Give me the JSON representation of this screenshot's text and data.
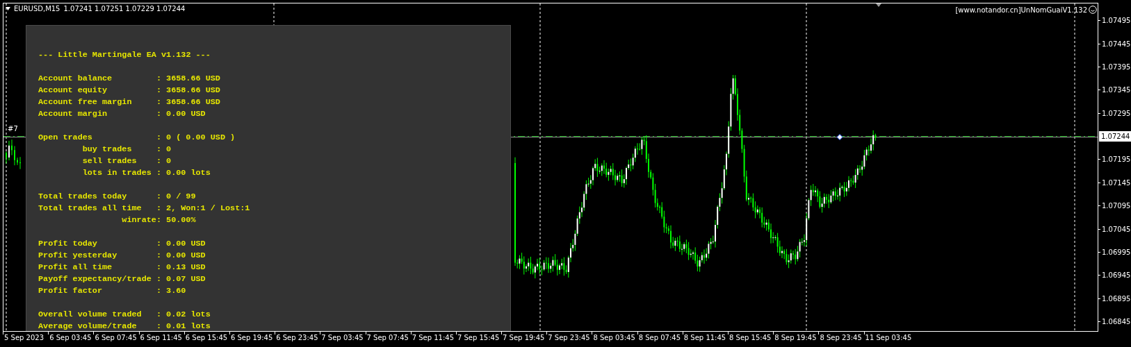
{
  "chart_header": {
    "symbol": "EURUSD,M15",
    "quotes": "1.07241 1.07251 1.07229 1.07244"
  },
  "indicator_label": "[www.notandor.cn]UnNomGuaiV1.132",
  "order_label": "#7",
  "panel": {
    "lines": [
      {
        "kind": "title",
        "text": "--- Little Martingale EA v1.132 ---"
      },
      {
        "kind": "gap"
      },
      {
        "kind": "row",
        "label": "Account balance",
        "value": ": 3658.66 USD"
      },
      {
        "kind": "row",
        "label": "Account equity",
        "value": ": 3658.66 USD"
      },
      {
        "kind": "row",
        "label": "Account free margin",
        "value": ": 3658.66 USD"
      },
      {
        "kind": "row",
        "label": "Account margin",
        "value": ": 0.00 USD"
      },
      {
        "kind": "gap"
      },
      {
        "kind": "row",
        "label": "Open trades",
        "value": ": 0 ( 0.00 USD )"
      },
      {
        "kind": "subrow",
        "label": "buy trades",
        "value": ": 0"
      },
      {
        "kind": "subrow",
        "label": "sell trades",
        "value": ": 0"
      },
      {
        "kind": "subrow",
        "label": "lots in trades",
        "value": ": 0.00 lots"
      },
      {
        "kind": "gap"
      },
      {
        "kind": "row",
        "label": "Total trades today",
        "value": ": 0 / 99"
      },
      {
        "kind": "row",
        "label": "Total trades all time",
        "value": ": 2, Won:1 / Lost:1"
      },
      {
        "kind": "right",
        "label": "winrate",
        "value": ": 50.00%"
      },
      {
        "kind": "gap"
      },
      {
        "kind": "row",
        "label": "Profit today",
        "value": ": 0.00 USD"
      },
      {
        "kind": "row",
        "label": "Profit yesterday",
        "value": ": 0.00 USD"
      },
      {
        "kind": "row",
        "label": "Profit all time",
        "value": ": 0.13 USD"
      },
      {
        "kind": "row",
        "label": "Payoff expectancy/trade",
        "value": ": 0.07 USD"
      },
      {
        "kind": "row",
        "label": "Profit factor",
        "value": ": 3.60"
      },
      {
        "kind": "gap"
      },
      {
        "kind": "row",
        "label": "Overall volume traded",
        "value": ": 0.02 lots"
      },
      {
        "kind": "row",
        "label": "Average volume/trade",
        "value": ": 0.01 lots"
      }
    ]
  },
  "price_axis": {
    "labels": [
      {
        "kind": "tick",
        "text": "1.07495"
      },
      {
        "kind": "tick",
        "text": "1.07445"
      },
      {
        "kind": "tick",
        "text": "1.07395"
      },
      {
        "kind": "tick",
        "text": "1.07345"
      },
      {
        "kind": "tick",
        "text": "1.07295"
      },
      {
        "kind": "current",
        "text": "1.07244"
      },
      {
        "kind": "tick",
        "text": "1.07195"
      },
      {
        "kind": "tick",
        "text": "1.07145"
      },
      {
        "kind": "tick",
        "text": "1.07095"
      },
      {
        "kind": "tick",
        "text": "1.07045"
      },
      {
        "kind": "tick",
        "text": "1.06995"
      },
      {
        "kind": "tick",
        "text": "1.06945"
      },
      {
        "kind": "tick",
        "text": "1.06895"
      },
      {
        "kind": "tick",
        "text": "1.06845"
      }
    ]
  },
  "time_axis": {
    "labels": [
      "5 Sep 2023",
      "6 Sep 03:45",
      "6 Sep 07:45",
      "6 Sep 11:45",
      "6 Sep 15:45",
      "6 Sep 19:45",
      "6 Sep 23:45",
      "7 Sep 03:45",
      "7 Sep 07:45",
      "7 Sep 11:45",
      "7 Sep 15:45",
      "7 Sep 19:45",
      "7 Sep 23:45",
      "8 Sep 03:45",
      "8 Sep 07:45",
      "8 Sep 11:45",
      "8 Sep 15:45",
      "8 Sep 19:45",
      "8 Sep 23:45",
      "11 Sep 03:45"
    ]
  }
}
